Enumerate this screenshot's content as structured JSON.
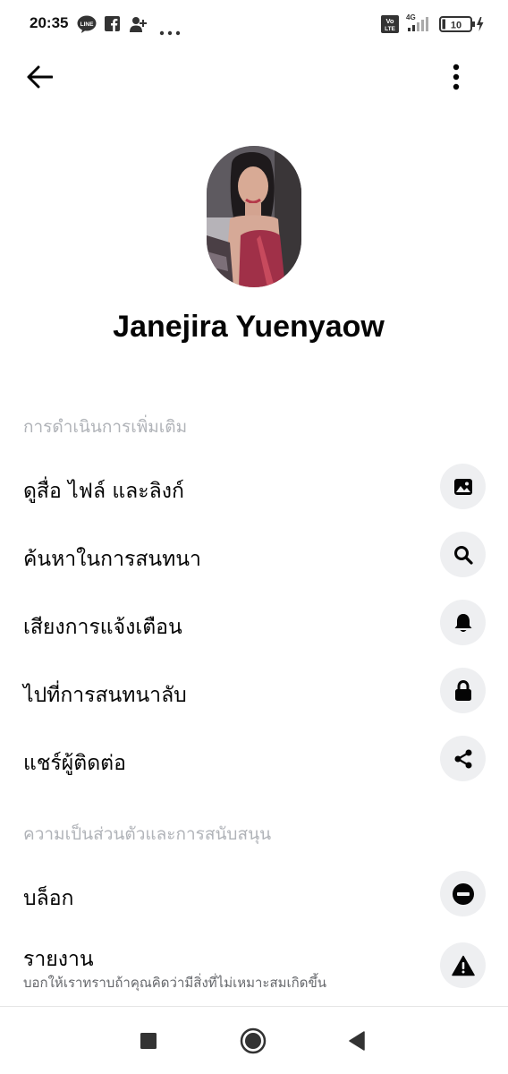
{
  "status_bar": {
    "time": "20:35",
    "notification_icons": [
      "line-icon",
      "facebook-icon",
      "person-add-icon",
      "more-dots-icon"
    ],
    "network": "4G",
    "volte_label_top": "Vo",
    "volte_label_bottom": "LTE",
    "battery_level": "10"
  },
  "app_bar": {
    "back_icon": "arrow-left-icon",
    "menu_icon": "vertical-dots-icon"
  },
  "profile": {
    "name": "Janejira Yuenyaow"
  },
  "sections": {
    "more_actions": "การดำเนินการเพิ่มเติม",
    "privacy_support": "ความเป็นส่วนตัวและการสนับสนุน"
  },
  "actions": [
    {
      "label": "ดูสื่อ ไฟล์ และลิงก์",
      "icon": "image-icon"
    },
    {
      "label": "ค้นหาในการสนทนา",
      "icon": "search-icon"
    },
    {
      "label": "เสียงการแจ้งเตือน",
      "icon": "bell-icon"
    },
    {
      "label": "ไปที่การสนทนาลับ",
      "icon": "lock-icon"
    },
    {
      "label": "แชร์ผู้ติดต่อ",
      "icon": "share-icon"
    }
  ],
  "privacy": {
    "block": {
      "label": "บล็อก",
      "icon": "block-icon"
    },
    "report": {
      "label": "รายงาน",
      "sublabel": "บอกให้เราทราบถ้าคุณคิดว่ามีสิ่งที่ไม่เหมาะสมเกิดขึ้น",
      "icon": "warning-icon"
    }
  },
  "nav_bar": {
    "icons": [
      "square-icon",
      "home-circle-icon",
      "back-triangle-icon"
    ]
  },
  "colors": {
    "text_primary": "#050505",
    "section_header": "#b0b3b8",
    "icon_bg": "#eeeff1"
  }
}
